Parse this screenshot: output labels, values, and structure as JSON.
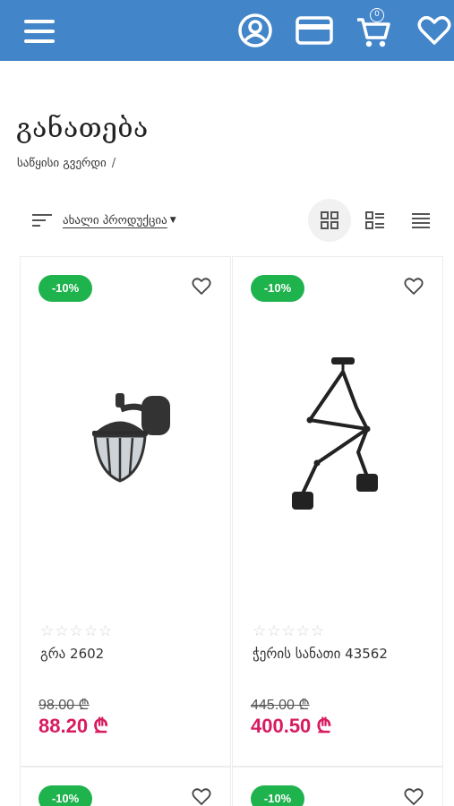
{
  "header": {
    "cart_count": "0",
    "icons": [
      "menu-icon",
      "account-icon",
      "card-icon",
      "cart-icon",
      "heart-icon"
    ],
    "color": "#4285c9"
  },
  "page": {
    "title": "განათება",
    "breadcrumb": {
      "home": "საწყისი გვერდი",
      "separator": "/"
    }
  },
  "toolbar": {
    "sort_label": "ახალი პროდუქცია",
    "views": [
      "grid-large",
      "grid-list",
      "list"
    ],
    "active_view": "grid-large"
  },
  "products": [
    {
      "discount": "-10%",
      "name": "გრა 2602",
      "old_price": "98.00 ₾",
      "price": "88.20 ₾",
      "rating": 0
    },
    {
      "discount": "-10%",
      "name": "ჭერის სანათი 43562",
      "old_price": "445.00 ₾",
      "price": "400.50 ₾",
      "rating": 0
    },
    {
      "discount": "-10%"
    },
    {
      "discount": "-10%"
    }
  ],
  "stars": "☆☆☆☆☆",
  "colors": {
    "discount": "#1fb34e",
    "price": "#d81b60"
  }
}
